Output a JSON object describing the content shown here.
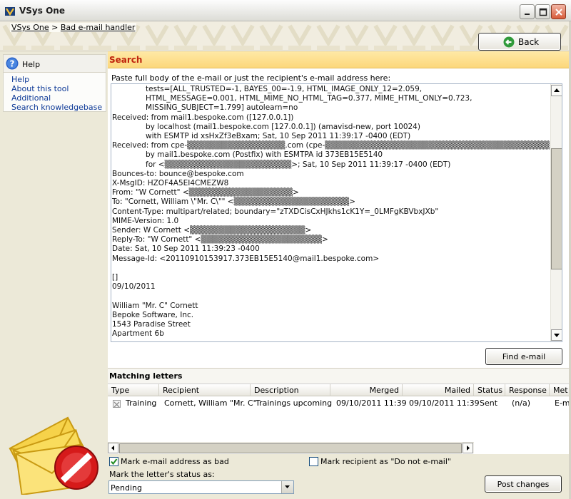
{
  "window": {
    "title": "VSys One",
    "icon": "vsys-logo-icon"
  },
  "breadcrumb": {
    "root": "VSys One",
    "separator": ">",
    "current": "Bad e-mail handler"
  },
  "back_button": {
    "label": "Back",
    "icon": "back-arrow-icon"
  },
  "help_panel": {
    "title": "Help",
    "links": [
      "Help",
      "About this tool",
      "Additional",
      "Search knowledgebase"
    ]
  },
  "search": {
    "section_title": "Search",
    "instruction": "Paste full body of the e-mail or just the recipient's e-mail address here:",
    "email_lines": [
      {
        "indent": 1,
        "text": "tests=[ALL_TRUSTED=-1, BAYES_00=-1.9, HTML_IMAGE_ONLY_12=2.059,"
      },
      {
        "indent": 1,
        "text": "HTML_MESSAGE=0.001, HTML_MIME_NO_HTML_TAG=0.377, MIME_HTML_ONLY=0.723,"
      },
      {
        "indent": 1,
        "text": "MISSING_SUBJECT=1.799] autolearn=no"
      },
      {
        "indent": 0,
        "text": "Received: from mail1.bespoke.com ([127.0.0.1])"
      },
      {
        "indent": 1,
        "text": "by localhost (mail1.bespoke.com [127.0.0.1]) (amavisd-new, port 10024)"
      },
      {
        "indent": 1,
        "text": "with ESMTP id xsHxZf3eBxam; Sat, 10 Sep 2011 11:39:17 -0400 (EDT)"
      },
      {
        "indent": 0,
        "text": "Received: from cpe-▒▒▒▒▒▒▒▒▒▒▒▒▒▒▒▒▒.com (cpe-▒▒▒▒▒▒▒▒▒▒▒▒▒▒▒▒▒▒▒▒▒▒▒▒▒▒▒▒▒▒▒▒▒▒▒▒▒▒▒▒▒▒▒▒▒▒▒▒▒▒)"
      },
      {
        "indent": 1,
        "text": "by mail1.bespoke.com (Postfix) with ESMTPA id 373EB15E5140"
      },
      {
        "indent": 1,
        "text": "for <▒▒▒▒▒▒▒▒▒▒▒▒▒▒▒▒▒▒▒▒▒▒>; Sat, 10 Sep 2011 11:39:17 -0400 (EDT)"
      },
      {
        "indent": 0,
        "text": "Bounces-to: bounce@bespoke.com"
      },
      {
        "indent": 0,
        "text": "X-MsgID: HZOF4A5EI4CMEZW8"
      },
      {
        "indent": 0,
        "text": "From: \"W Cornett\" <▒▒▒▒▒▒▒▒▒▒▒▒▒▒▒▒▒▒>"
      },
      {
        "indent": 0,
        "text": "To: \"Cornett, William \\\"Mr. C\\\"\" <▒▒▒▒▒▒▒▒▒▒▒▒▒▒▒▒▒▒▒▒>"
      },
      {
        "indent": 0,
        "text": "Content-Type: multipart/related; boundary=\"zTXDCisCxHJkhs1cK1Y=_0LMFgKBVbxJXb\""
      },
      {
        "indent": 0,
        "text": "MIME-Version: 1.0"
      },
      {
        "indent": 0,
        "text": "Sender: W Cornett <▒▒▒▒▒▒▒▒▒▒▒▒▒▒▒▒▒▒▒▒>"
      },
      {
        "indent": 0,
        "text": "Reply-To: \"W Cornett\" <▒▒▒▒▒▒▒▒▒▒▒▒▒▒▒▒▒▒▒▒▒>"
      },
      {
        "indent": 0,
        "text": "Date: Sat, 10 Sep 2011 11:39:23 -0400"
      },
      {
        "indent": 0,
        "text": "Message-Id: <20110910153917.373EB15E5140@mail1.bespoke.com>"
      },
      {
        "indent": 0,
        "text": ""
      },
      {
        "indent": 0,
        "text": "[]"
      },
      {
        "indent": 0,
        "text": "09/10/2011"
      },
      {
        "indent": 0,
        "text": ""
      },
      {
        "indent": 0,
        "text": "William \"Mr. C\" Cornett"
      },
      {
        "indent": 0,
        "text": "Bepoke Software, Inc."
      },
      {
        "indent": 0,
        "text": "1543 Paradise Street"
      },
      {
        "indent": 0,
        "text": "Apartment 6b"
      }
    ],
    "find_button": "Find e-mail"
  },
  "matching": {
    "section_title": "Matching letters",
    "columns": [
      "Type",
      "Recipient",
      "Description",
      "Merged",
      "Mailed",
      "Status",
      "Response",
      "Met"
    ],
    "rows": [
      {
        "type": "Training",
        "recipient": "Cornett, William \"Mr. C\"",
        "description": "Trainings upcoming",
        "merged": "09/10/2011 11:39",
        "mailed": "09/10/2011 11:39",
        "status": "Sent",
        "response": "(n/a)",
        "method": "E-m"
      }
    ]
  },
  "controls": {
    "mark_bad_label": "Mark e-mail address as bad",
    "mark_bad_checked": true,
    "do_not_email_label": "Mark recipient as \"Do not e-mail\"",
    "do_not_email_checked": false,
    "status_label": "Mark the letter's status as:",
    "status_value": "Pending",
    "post_button": "Post changes"
  },
  "colors": {
    "search_header": "#fcd77b",
    "search_title": "#c0240d",
    "link": "#0c3896"
  }
}
